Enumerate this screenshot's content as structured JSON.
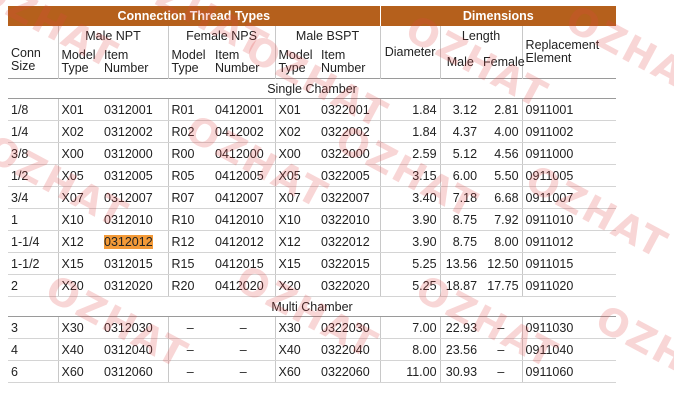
{
  "header": {
    "connection": "Connection Thread Types",
    "dimensions": "Dimensions"
  },
  "groups": {
    "male_npt": "Male NPT",
    "female_nps": "Female NPS",
    "male_bspt": "Male BSPT",
    "diameter": "Diameter",
    "length": "Length",
    "replacement_line1": "Replacement",
    "replacement_line2": "Element"
  },
  "columns": {
    "conn_line1": "Conn",
    "conn_line2": "Size",
    "model_line1": "Model",
    "model_line2": "Type",
    "item_line1": "Item",
    "item_line2": "Number",
    "male": "Male",
    "female": "Female"
  },
  "sections": {
    "single": "Single Chamber",
    "multi": "Multi Chamber"
  },
  "single_rows": [
    [
      "1/8",
      "X01",
      "0312001",
      "R01",
      "0412001",
      "X01",
      "0322001",
      "1.84",
      "3.12",
      "2.81",
      "0911001"
    ],
    [
      "1/4",
      "X02",
      "0312002",
      "R02",
      "0412002",
      "X02",
      "0322002",
      "1.84",
      "4.37",
      "4.00",
      "0911002"
    ],
    [
      "3/8",
      "X00",
      "0312000",
      "R00",
      "0412000",
      "X00",
      "0322000",
      "2.59",
      "5.12",
      "4.56",
      "0911000"
    ],
    [
      "1/2",
      "X05",
      "0312005",
      "R05",
      "0412005",
      "X05",
      "0322005",
      "3.15",
      "6.00",
      "5.50",
      "0911005"
    ],
    [
      "3/4",
      "X07",
      "0312007",
      "R07",
      "0412007",
      "X07",
      "0322007",
      "3.40",
      "7.18",
      "6.68",
      "0911007"
    ],
    [
      "1",
      "X10",
      "0312010",
      "R10",
      "0412010",
      "X10",
      "0322010",
      "3.90",
      "8.75",
      "7.92",
      "0911010"
    ],
    [
      "1-1/4",
      "X12",
      "0312012",
      "R12",
      "0412012",
      "X12",
      "0322012",
      "3.90",
      "8.75",
      "8.00",
      "0911012"
    ],
    [
      "1-1/2",
      "X15",
      "0312015",
      "R15",
      "0412015",
      "X15",
      "0322015",
      "5.25",
      "13.56",
      "12.50",
      "0911015"
    ],
    [
      "2",
      "X20",
      "0312020",
      "R20",
      "0412020",
      "X20",
      "0322020",
      "5.25",
      "18.87",
      "17.75",
      "0911020"
    ]
  ],
  "multi_rows": [
    [
      "3",
      "X30",
      "0312030",
      "–",
      "–",
      "X30",
      "0322030",
      "7.00",
      "22.93",
      "–",
      "0911030"
    ],
    [
      "4",
      "X40",
      "0312040",
      "–",
      "–",
      "X40",
      "0322040",
      "8.00",
      "23.56",
      "–",
      "0911040"
    ],
    [
      "6",
      "X60",
      "0312060",
      "–",
      "–",
      "X60",
      "0322060",
      "11.00",
      "30.93",
      "–",
      "0911060"
    ]
  ],
  "highlight": {
    "row": 6,
    "col": 2,
    "color": "#f39a38"
  },
  "colors": {
    "header_bg": "#b5601c",
    "watermark": "#e04646"
  },
  "watermark": "OZHAT"
}
